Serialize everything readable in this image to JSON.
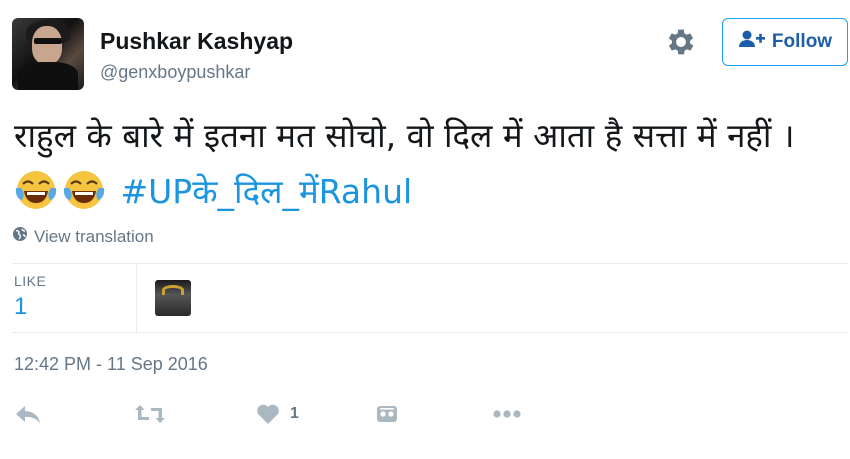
{
  "user": {
    "display_name": "Pushkar Kashyap",
    "handle": "@genxboypushkar"
  },
  "actions_top": {
    "follow_label": "Follow",
    "settings_icon": "gear-icon",
    "follow_icon": "add-user-icon"
  },
  "tweet": {
    "text": "राहुल के बारे में इतना मत सोचो, वो दिल में आता है सत्ता में नहीं ।",
    "emojis": [
      "face-with-tears-of-joy",
      "face-with-tears-of-joy"
    ],
    "hashtag": "#UPके_दिल_मेंRahul"
  },
  "translate": {
    "label": "View translation",
    "icon": "globe-icon"
  },
  "stats": {
    "likes_label": "LIKE",
    "likes_count": "1"
  },
  "timestamp": "12:42 PM - 11 Sep 2016",
  "footer": {
    "reply_icon": "reply-icon",
    "retweet_icon": "retweet-icon",
    "like_icon": "heart-icon",
    "like_count": "1",
    "dm_icon": "direct-message-icon",
    "more_icon": "more-icon"
  },
  "colors": {
    "link": "#1b95e0",
    "muted": "#657786",
    "text": "#14171a",
    "border": "#e6ecf0"
  }
}
